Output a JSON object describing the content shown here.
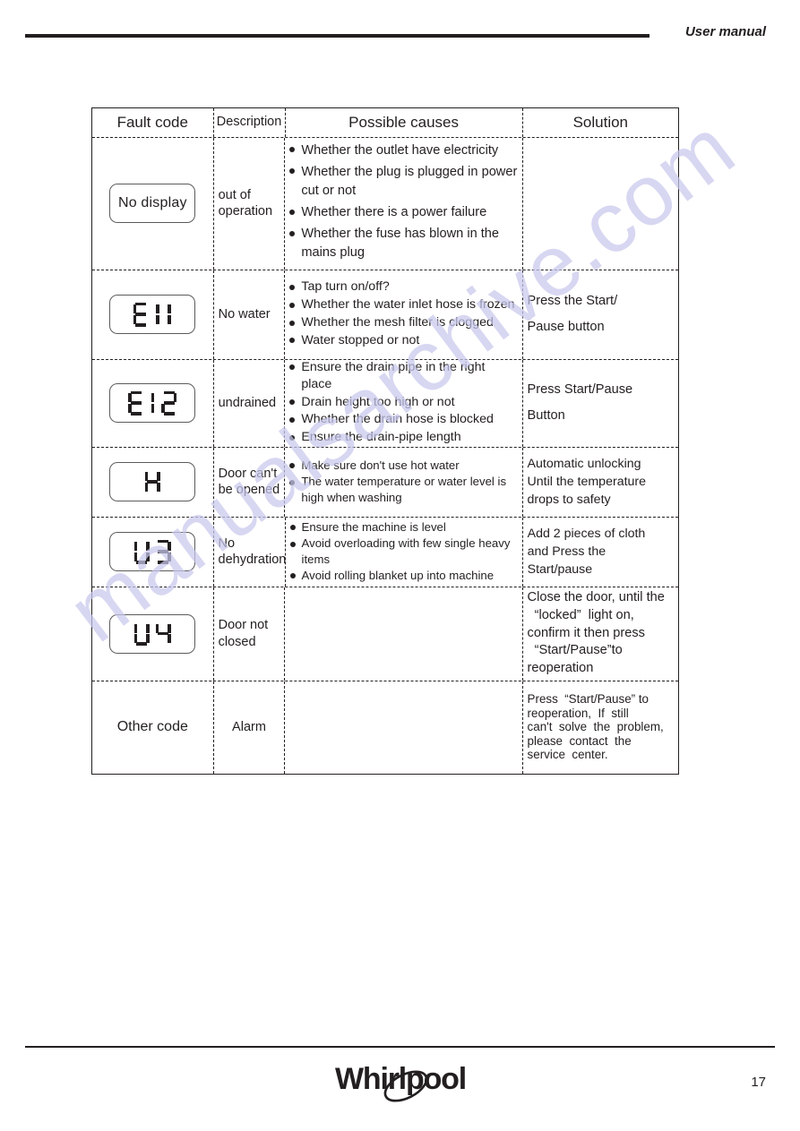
{
  "header": {
    "title": "User manual"
  },
  "table": {
    "columns": [
      "Fault code",
      "Description",
      "Possible causes",
      "Solution"
    ],
    "rows": [
      {
        "code_display": "No display",
        "code_style": "text",
        "description": "out of\noperation",
        "causes": [
          "Whether the outlet have electricity",
          "Whether the plug is plugged in power cut or not",
          "Whether there is a power failure",
          "Whether the fuse has blown in the mains plug"
        ],
        "solution": ""
      },
      {
        "code_display": "E11",
        "code_style": "seven-segment",
        "description": "No water",
        "causes": [
          "Tap turn on/off?",
          "Whether the water inlet hose is frozen",
          "Whether the mesh filter is clogged",
          "Water stopped or not"
        ],
        "solution": "Press the Start/\nPause button"
      },
      {
        "code_display": "E12",
        "code_style": "seven-segment",
        "description": "undrained",
        "causes": [
          "Ensure the drain pipe in the right place",
          "Drain height too high or not",
          "Whether the drain hose is blocked",
          "Ensure the drain-pipe length"
        ],
        "solution": "Press Start/Pause\nButton"
      },
      {
        "code_display": "H",
        "code_style": "seven-segment",
        "description": "Door can't\nbe opened",
        "causes": [
          "Make sure don't use hot water",
          "The water temperature or water level is high when washing"
        ],
        "solution": "Automatic unlocking\nUntil the temperature\ndrops to safety"
      },
      {
        "code_display": "U3",
        "code_style": "seven-segment",
        "description": "No\ndehydration",
        "causes": [
          "Ensure the machine is level",
          "Avoid overloading with few single heavy items",
          "Avoid rolling blanket up into machine"
        ],
        "solution": "Add 2 pieces of cloth\nand Press the\nStart/pause"
      },
      {
        "code_display": "U4",
        "code_style": "seven-segment",
        "description": "Door not\nclosed",
        "causes": [],
        "solution": "Close the door, until the\n  “locked”  light on,\nconfirm it then press\n  “Start/Pause”to\nreoperation"
      },
      {
        "code_display": "Other code",
        "code_style": "plain",
        "description": "Alarm",
        "causes": [],
        "solution": "Press  “Start/Pause” to\nreoperation,  If  still\ncan't  solve  the  problem,\nplease  contact  the\nservice  center."
      }
    ]
  },
  "footer": {
    "brand": "Whirlpool",
    "page_number": "17"
  },
  "watermark": {
    "text": "manualsarchive.com",
    "color": "#c9c9ee"
  },
  "colors": {
    "ink": "#231f20",
    "chip_border": "#5b5b5b",
    "paper": "#ffffff"
  }
}
